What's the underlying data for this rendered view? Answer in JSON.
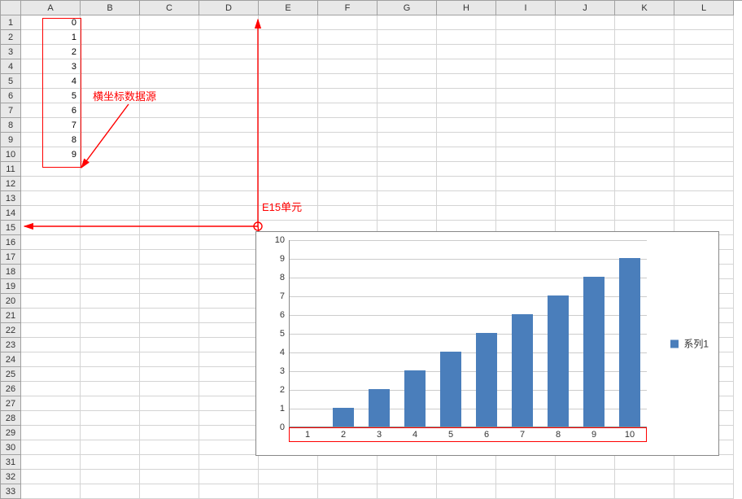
{
  "spreadsheet": {
    "columns": [
      "A",
      "B",
      "C",
      "D",
      "E",
      "F",
      "G",
      "H",
      "I",
      "J",
      "K",
      "L"
    ],
    "row_count": 33,
    "cells": {
      "A1": "0",
      "A2": "1",
      "A3": "2",
      "A4": "3",
      "A5": "4",
      "A6": "5",
      "A7": "6",
      "A8": "7",
      "A9": "8",
      "A10": "9"
    }
  },
  "annotations": {
    "data_source_label": "横坐标数据源",
    "anchor_cell_label": "E15单元"
  },
  "chart_data": {
    "type": "bar",
    "categories": [
      "1",
      "2",
      "3",
      "4",
      "5",
      "6",
      "7",
      "8",
      "9",
      "10"
    ],
    "values": [
      0,
      1,
      2,
      3,
      4,
      5,
      6,
      7,
      8,
      9
    ],
    "series_name": "系列1",
    "ylim": [
      0,
      10
    ],
    "y_ticks": [
      0,
      1,
      2,
      3,
      4,
      5,
      6,
      7,
      8,
      9,
      10
    ],
    "bar_color": "#4a7ebb"
  },
  "legend": {
    "label": "系列1"
  }
}
